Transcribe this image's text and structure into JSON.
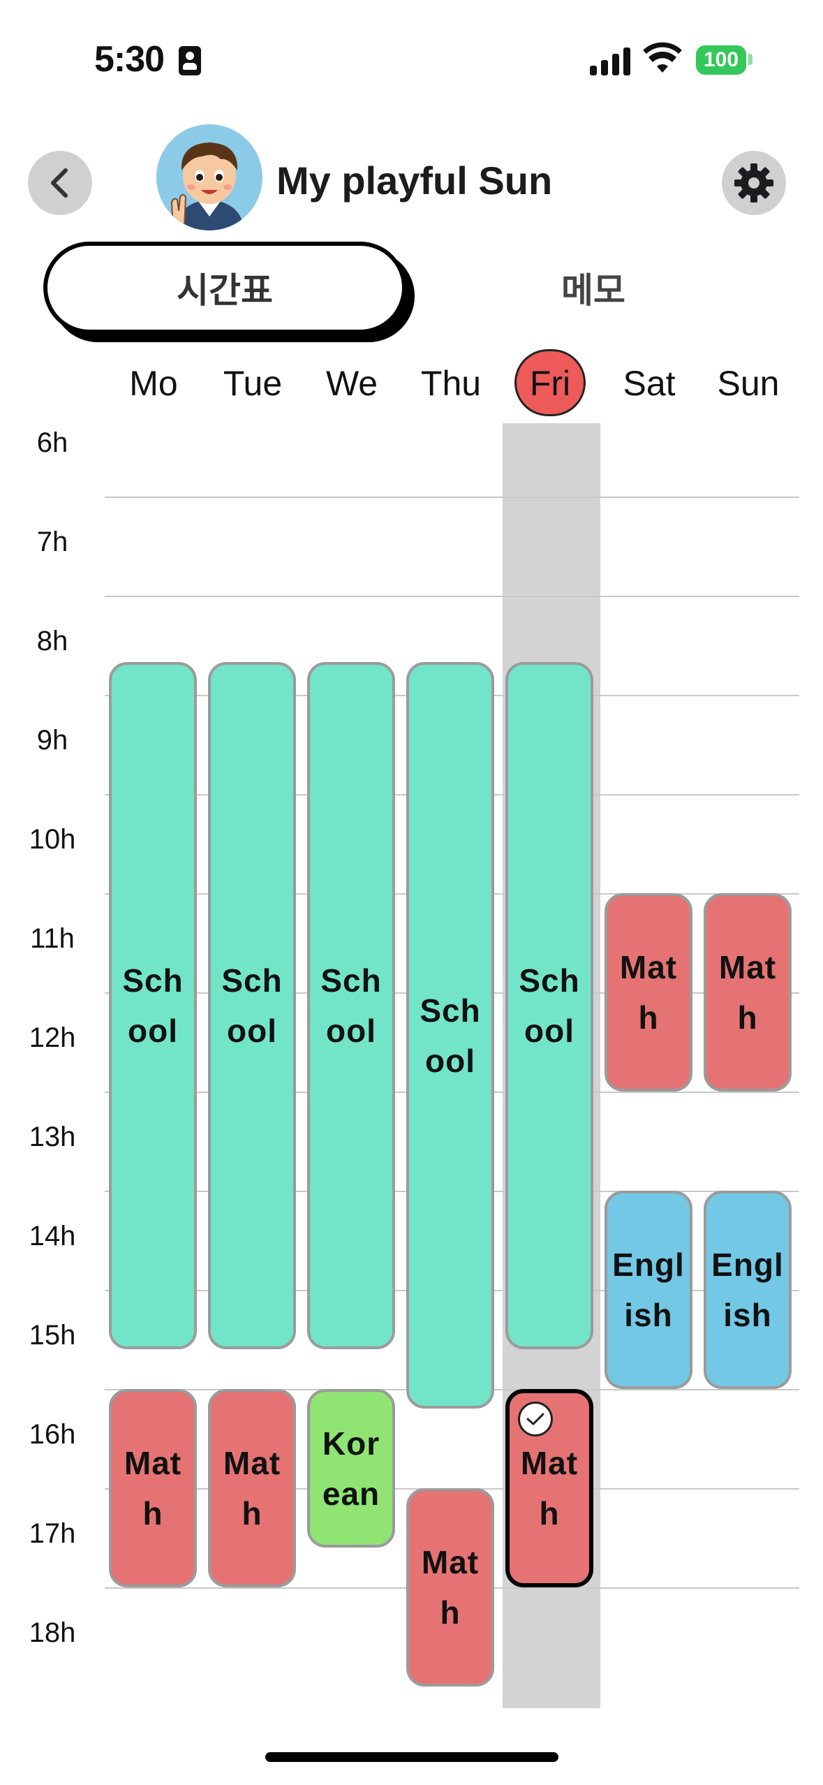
{
  "status": {
    "time": "5:30",
    "battery": "100"
  },
  "header": {
    "title": "My playful Sun"
  },
  "tabs": [
    {
      "label": "시간표",
      "active": true
    },
    {
      "label": "메모",
      "active": false
    }
  ],
  "days": [
    "Mo",
    "Tue",
    "We",
    "Thu",
    "Fri",
    "Sat",
    "Sun"
  ],
  "today": "Fri",
  "hours": [
    "6h",
    "7h",
    "8h",
    "9h",
    "10h",
    "11h",
    "12h",
    "13h",
    "14h",
    "15h",
    "16h",
    "17h",
    "18h"
  ],
  "colors": {
    "school": "#72e5c8",
    "math": "#e57373",
    "english": "#73c8e5",
    "korean": "#90e474",
    "today": "#ee5a5a"
  },
  "events": [
    {
      "day": "Mo",
      "start": 8.67,
      "end": 15.6,
      "label": "Sch\nool",
      "subject": "school"
    },
    {
      "day": "Tue",
      "start": 8.67,
      "end": 15.6,
      "label": "Sch\nool",
      "subject": "school"
    },
    {
      "day": "We",
      "start": 8.67,
      "end": 15.6,
      "label": "Sch\nool",
      "subject": "school"
    },
    {
      "day": "Thu",
      "start": 8.67,
      "end": 16.2,
      "label": "Sch\nool",
      "subject": "school"
    },
    {
      "day": "Fri",
      "start": 8.67,
      "end": 15.6,
      "label": "Sch\nool",
      "subject": "school"
    },
    {
      "day": "Sat",
      "start": 11.0,
      "end": 13.0,
      "label": "Mat\nh",
      "subject": "math"
    },
    {
      "day": "Sun",
      "start": 11.0,
      "end": 13.0,
      "label": "Mat\nh",
      "subject": "math"
    },
    {
      "day": "Sat",
      "start": 14.0,
      "end": 16.0,
      "label": "Engl\nish",
      "subject": "english"
    },
    {
      "day": "Sun",
      "start": 14.0,
      "end": 16.0,
      "label": "Engl\nish",
      "subject": "english"
    },
    {
      "day": "Mo",
      "start": 16.0,
      "end": 18.0,
      "label": "Mat\nh",
      "subject": "math"
    },
    {
      "day": "Tue",
      "start": 16.0,
      "end": 18.0,
      "label": "Mat\nh",
      "subject": "math"
    },
    {
      "day": "We",
      "start": 16.0,
      "end": 17.6,
      "label": "Kor\nean",
      "subject": "korean"
    },
    {
      "day": "Fri",
      "start": 16.0,
      "end": 18.0,
      "label": "Mat\nh",
      "subject": "math",
      "checked": true
    },
    {
      "day": "Thu",
      "start": 17.0,
      "end": 19.0,
      "label": "Mat\nh",
      "subject": "math"
    }
  ]
}
